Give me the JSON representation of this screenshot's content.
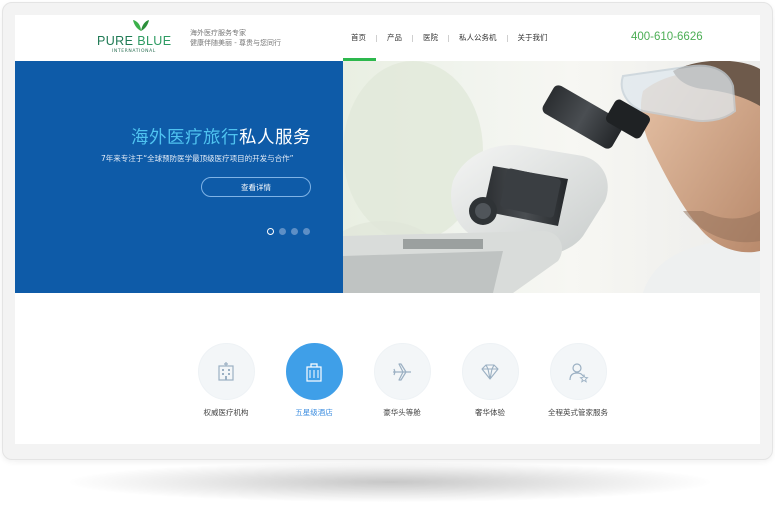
{
  "brand": {
    "logo_main_a": "PURE ",
    "logo_main_b": "BLUE",
    "logo_sub": "INTERNATIONAL",
    "slogan_line1": "海外医疗服务专家",
    "slogan_line2": "健康伴随美丽 - 尊贵与您同行",
    "green": "#2d9b62"
  },
  "nav": {
    "items": [
      {
        "label": "首页",
        "active": true
      },
      {
        "label": "产品"
      },
      {
        "label": "医院"
      },
      {
        "label": "私人公务机"
      },
      {
        "label": "关于我们"
      }
    ],
    "active_color": "#2db84d"
  },
  "phone": "400-610-6626",
  "banner": {
    "title_highlight": "海外医疗旅行",
    "title_rest": "私人服务",
    "subtitle": "7年来专注于“全球预防医学最顶级医疗项目的开发与合作”",
    "button_label": "查看详情",
    "slides_total": 4,
    "slide_active": 1,
    "bg_color": "#0e5ba8",
    "image_icon": "scientist-microscope-photo"
  },
  "features": [
    {
      "label": "权威医疗机构",
      "icon": "hospital-icon"
    },
    {
      "label": "五星级酒店",
      "icon": "hotel-icon",
      "active": true
    },
    {
      "label": "豪华头等舱",
      "icon": "airplane-icon"
    },
    {
      "label": "奢华体验",
      "icon": "diamond-icon"
    },
    {
      "label": "全程英式管家服务",
      "icon": "butler-icon"
    }
  ]
}
